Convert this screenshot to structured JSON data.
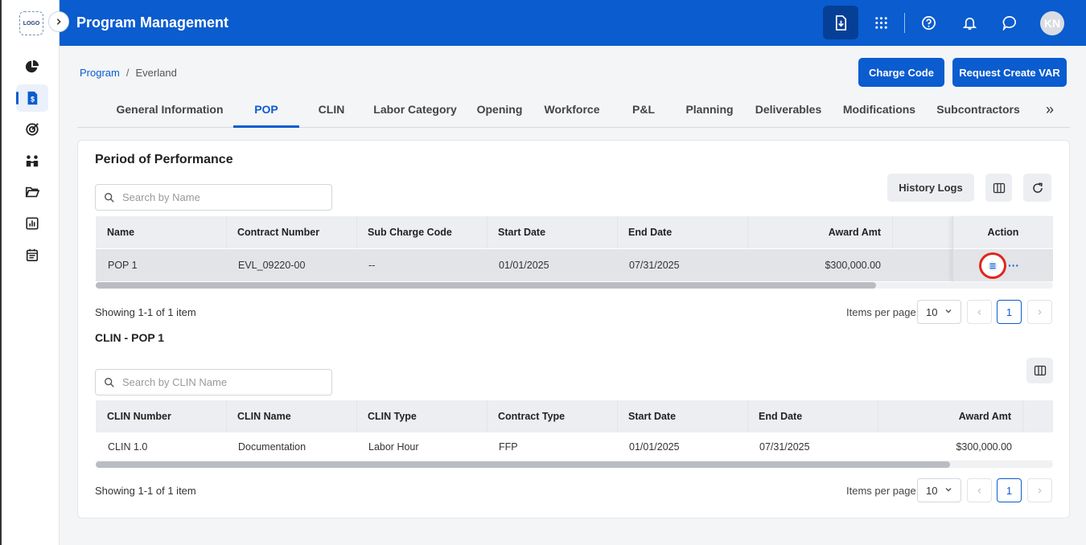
{
  "header": {
    "title": "Program Management",
    "avatar_initials": "KN",
    "icons": [
      "download-icon",
      "apps-grid-icon",
      "help-icon",
      "bell-icon",
      "chat-icon"
    ]
  },
  "sidebar": {
    "logo_text": "LOGO",
    "items": [
      "pie-chart-icon",
      "invoice-icon",
      "target-icon",
      "people-icon",
      "folder-icon",
      "report-icon",
      "calendar-icon"
    ],
    "active_index": 1
  },
  "breadcrumb": {
    "root": "Program",
    "separator": "/",
    "current": "Everland"
  },
  "actions": {
    "charge_code": "Charge Code",
    "request_var": "Request Create VAR"
  },
  "tabs": [
    "General Information",
    "POP",
    "CLIN",
    "Labor Category",
    "Opening",
    "Workforce",
    "P&L",
    "Planning",
    "Deliverables",
    "Modifications",
    "Subcontractors"
  ],
  "active_tab": "POP",
  "tabs_more": "»",
  "pop": {
    "title": "Period of Performance",
    "search_placeholder": "Search by Name",
    "history_logs": "History Logs",
    "columns": {
      "name": "Name",
      "contract_number": "Contract Number",
      "sub_charge_code": "Sub Charge Code",
      "start_date": "Start Date",
      "end_date": "End Date",
      "award_amt": "Award Amt",
      "action": "Action"
    },
    "rows": [
      {
        "name": "POP 1",
        "contract_number": "EVL_09220-00",
        "sub_charge_code": "--",
        "start_date": "01/01/2025",
        "end_date": "07/31/2025",
        "award_amt": "$300,000.00"
      }
    ],
    "row_more": "···",
    "showing": "Showing 1-1 of 1 item",
    "items_per_page_label": "Items per page",
    "items_per_page": "10",
    "page": "1"
  },
  "clin": {
    "title": "CLIN - POP 1",
    "search_placeholder": "Search by CLIN Name",
    "columns": {
      "clin_number": "CLIN Number",
      "clin_name": "CLIN Name",
      "clin_type": "CLIN Type",
      "contract_type": "Contract Type",
      "start_date": "Start Date",
      "end_date": "End Date",
      "award_amt": "Award Amt"
    },
    "rows": [
      {
        "clin_number": "CLIN 1.0",
        "clin_name": "Documentation",
        "clin_type": "Labor Hour",
        "contract_type": "FFP",
        "start_date": "01/01/2025",
        "end_date": "07/31/2025",
        "award_amt": "$300,000.00"
      }
    ],
    "showing": "Showing 1-1 of 1 item",
    "items_per_page_label": "Items per page",
    "items_per_page": "10",
    "page": "1"
  },
  "colors": {
    "primary": "#0a5ccf",
    "header_dark": "#063f96",
    "highlight_ring": "#e0261b"
  }
}
